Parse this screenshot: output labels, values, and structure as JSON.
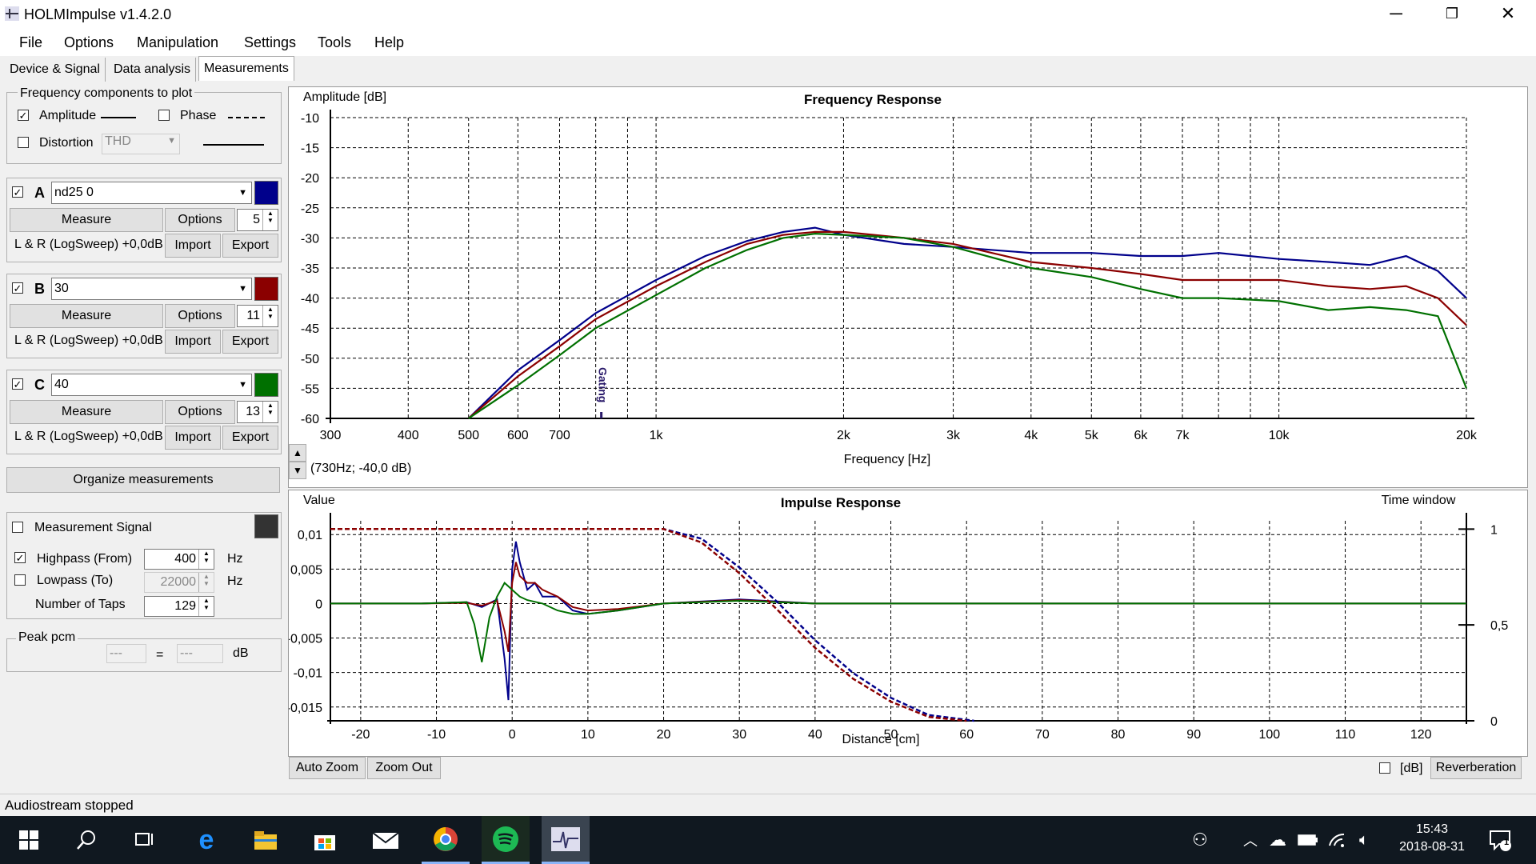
{
  "app": {
    "title": "HOLMImpulse  v1.4.2.0"
  },
  "menu": [
    "File",
    "Options",
    "Manipulation",
    "Settings",
    "Tools",
    "Help"
  ],
  "tabs": [
    "Device & Signal",
    "Data analysis",
    "Measurements"
  ],
  "freq_components": {
    "legend": "Frequency components to plot",
    "amplitude_label": "Amplitude",
    "amplitude_checked": true,
    "phase_label": "Phase",
    "phase_checked": false,
    "distortion_label": "Distortion",
    "distortion_checked": false,
    "distortion_value": "THD"
  },
  "measurements": [
    {
      "letter": "A",
      "name": "nd25 0",
      "color": "#00008b",
      "checked": true,
      "measure": "Measure",
      "options": "Options",
      "spin": "5",
      "desc": "L & R (LogSweep) +0,0dB",
      "import": "Import",
      "export": "Export"
    },
    {
      "letter": "B",
      "name": "30",
      "color": "#8b0000",
      "checked": true,
      "measure": "Measure",
      "options": "Options",
      "spin": "11",
      "desc": "L & R (LogSweep) +0,0dB",
      "import": "Import",
      "export": "Export"
    },
    {
      "letter": "C",
      "name": "40",
      "color": "#007000",
      "checked": true,
      "measure": "Measure",
      "options": "Options",
      "spin": "13",
      "desc": "L & R (LogSweep) +0,0dB",
      "import": "Import",
      "export": "Export"
    }
  ],
  "organize_label": "Organize measurements",
  "signal": {
    "measurement_signal_label": "Measurement Signal",
    "highpass_label": "Highpass (From)",
    "highpass_value": "400",
    "highpass_unit": "Hz",
    "lowpass_label": "Lowpass (To)",
    "lowpass_value": "22000",
    "lowpass_unit": "Hz",
    "taps_label": "Number of Taps",
    "taps_value": "129"
  },
  "peak": {
    "legend": "Peak pcm",
    "left": "---",
    "eq": "=",
    "right": "---",
    "unit": "dB"
  },
  "freq_chart_texts": {
    "title": "Frequency Response",
    "ylabel": "Amplitude [dB]",
    "xlabel": "Frequency [Hz]",
    "cursor": "(730Hz; -40,0 dB)",
    "marker": "Gating"
  },
  "impulse_chart_texts": {
    "title": "Impulse Response",
    "ylabel": "Value",
    "xlabel": "Distance [cm]",
    "right_label": "Time window"
  },
  "bottom_buttons": {
    "auto_zoom": "Auto Zoom",
    "zoom_out": "Zoom Out",
    "db_label": "[dB]",
    "reverberation": "Reverberation"
  },
  "status": "Audiostream stopped",
  "clock": {
    "time": "15:43",
    "date": "2018-08-31"
  },
  "notifications": "1",
  "colors": {
    "A": "#00008b",
    "B": "#8b0000",
    "C": "#007000"
  },
  "chart_data": [
    {
      "type": "line",
      "title": "Frequency Response",
      "xlabel": "Frequency [Hz]",
      "ylabel": "Amplitude [dB]",
      "xscale": "log",
      "xlim": [
        300,
        20000
      ],
      "ylim": [
        -60,
        -10
      ],
      "xticks": [
        "300",
        "400",
        "500",
        "600",
        "700",
        "1k",
        "2k",
        "3k",
        "4k",
        "5k",
        "6k",
        "7k",
        "10k",
        "20k"
      ],
      "yticks": [
        "-10",
        "-15",
        "-20",
        "-25",
        "-30",
        "-35",
        "-40",
        "-45",
        "-50",
        "-55",
        "-60"
      ],
      "grid": true,
      "series": [
        {
          "name": "A",
          "x": [
            500,
            600,
            700,
            800,
            1000,
            1200,
            1400,
            1600,
            1800,
            2000,
            2500,
            3000,
            4000,
            5000,
            6000,
            7000,
            8000,
            10000,
            12000,
            14000,
            16000,
            18000,
            20000
          ],
          "y": [
            -60,
            -52,
            -47,
            -42.5,
            -37,
            -33,
            -30.5,
            -29,
            -28.3,
            -29.5,
            -31,
            -31.5,
            -32.5,
            -32.5,
            -33,
            -33,
            -32.5,
            -33.5,
            -34,
            -34.5,
            -33,
            -35.5,
            -40
          ]
        },
        {
          "name": "B",
          "x": [
            500,
            600,
            700,
            800,
            1000,
            1200,
            1400,
            1600,
            1800,
            2000,
            2500,
            3000,
            4000,
            5000,
            6000,
            7000,
            8000,
            10000,
            12000,
            14000,
            16000,
            18000,
            20000
          ],
          "y": [
            -61,
            -53,
            -48,
            -43.5,
            -38,
            -34,
            -31,
            -29.5,
            -29,
            -29,
            -30,
            -31,
            -34,
            -35,
            -36,
            -37,
            -37,
            -37,
            -38,
            -38.5,
            -38,
            -40,
            -44.5
          ]
        },
        {
          "name": "C",
          "x": [
            500,
            600,
            700,
            800,
            1000,
            1200,
            1400,
            1600,
            1800,
            2000,
            2500,
            3000,
            4000,
            5000,
            6000,
            7000,
            8000,
            10000,
            12000,
            14000,
            16000,
            18000,
            20000
          ],
          "y": [
            -62,
            -54.5,
            -49.5,
            -45,
            -39.5,
            -35,
            -32,
            -30,
            -29.3,
            -29.5,
            -30,
            -31.5,
            -35,
            -36.5,
            -38.5,
            -40,
            -40,
            -40.5,
            -42,
            -41.5,
            -42,
            -43,
            -55
          ]
        }
      ]
    },
    {
      "type": "line",
      "title": "Impulse Response",
      "xlabel": "Distance [cm]",
      "ylabel": "Value",
      "xlim": [
        -24,
        126
      ],
      "ylim": [
        -0.017,
        0.012
      ],
      "xticks": [
        "-20",
        "-10",
        "0",
        "10",
        "20",
        "30",
        "40",
        "50",
        "60",
        "70",
        "80",
        "90",
        "100",
        "110",
        "120"
      ],
      "yticks": [
        "0,01",
        "0,005",
        "0",
        "-0,005",
        "-0,01",
        "-0,015"
      ],
      "y2ticks": [
        "1",
        "0,5",
        "0"
      ],
      "grid": true,
      "series": [
        {
          "name": "A",
          "x": [
            -24,
            -12,
            -6,
            -4,
            -2,
            -1,
            -0.5,
            0,
            0.5,
            1,
            2,
            3,
            4,
            6,
            8,
            10,
            14,
            20,
            30,
            40,
            60,
            80,
            100,
            126
          ],
          "y": [
            0,
            0,
            0.0002,
            -0.0005,
            0.0006,
            -0.008,
            -0.014,
            0.005,
            0.009,
            0.006,
            0.002,
            0.003,
            0.001,
            0.001,
            -0.001,
            -0.0015,
            -0.001,
            0,
            0.0006,
            0,
            0,
            0,
            0,
            0
          ]
        },
        {
          "name": "B",
          "x": [
            -24,
            -12,
            -6,
            -4,
            -2,
            -1,
            -0.5,
            0,
            0.5,
            1,
            2,
            3,
            4,
            6,
            8,
            10,
            14,
            20,
            30,
            40,
            60,
            80,
            100,
            126
          ],
          "y": [
            0,
            0,
            0.0001,
            -0.0003,
            0.0004,
            -0.004,
            -0.007,
            0.003,
            0.006,
            0.004,
            0.003,
            0.003,
            0.002,
            0.001,
            -0.0005,
            -0.001,
            -0.0008,
            0,
            0.0005,
            0,
            0,
            0,
            0,
            0
          ]
        },
        {
          "name": "C",
          "x": [
            -24,
            -12,
            -6,
            -5,
            -4,
            -3,
            -2,
            -1,
            0,
            1,
            2,
            4,
            6,
            8,
            10,
            14,
            20,
            30,
            40,
            60,
            80,
            100,
            126
          ],
          "y": [
            0,
            0,
            0.0002,
            -0.003,
            -0.0085,
            -0.002,
            0.001,
            0.003,
            0.002,
            0.001,
            0.0005,
            0,
            -0.001,
            -0.0015,
            -0.0015,
            -0.001,
            0,
            0.0004,
            0,
            0,
            0,
            0,
            0
          ]
        },
        {
          "name": "Window A",
          "axis": "right",
          "x": [
            -24,
            20,
            25,
            30,
            35,
            40,
            45,
            50,
            55,
            61
          ],
          "y": [
            1,
            1,
            0.95,
            0.8,
            0.62,
            0.42,
            0.25,
            0.12,
            0.03,
            0
          ]
        },
        {
          "name": "Window B",
          "axis": "right",
          "x": [
            -24,
            20,
            25,
            30,
            35,
            40,
            45,
            50,
            55,
            60
          ],
          "y": [
            1,
            1,
            0.93,
            0.77,
            0.58,
            0.38,
            0.22,
            0.1,
            0.02,
            0
          ]
        }
      ]
    }
  ]
}
